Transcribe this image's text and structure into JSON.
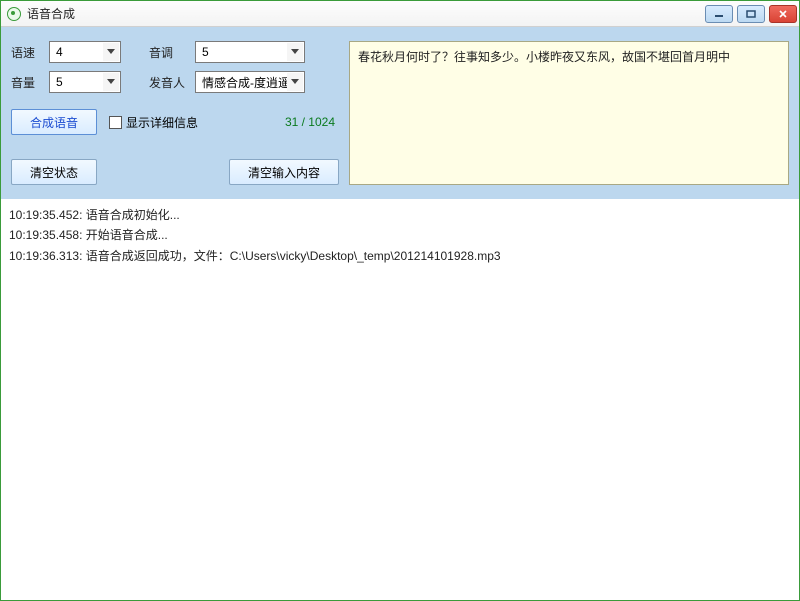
{
  "window": {
    "title": "语音合成"
  },
  "controls": {
    "speed_label": "语速",
    "speed_value": "4",
    "pitch_label": "音调",
    "pitch_value": "5",
    "volume_label": "音量",
    "volume_value": "5",
    "speaker_label": "发音人",
    "speaker_value": "情感合成-度逍遥"
  },
  "actions": {
    "synthesize_label": "合成语音",
    "show_detail_label": "显示详细信息",
    "clear_status_label": "清空状态",
    "clear_input_label": "清空输入内容"
  },
  "counter": {
    "text": "31 / 1024"
  },
  "input": {
    "text": "春花秋月何时了？往事知多少。小楼昨夜又东风，故国不堪回首月明中"
  },
  "log": {
    "lines": [
      "10:19:35.452: 语音合成初始化...",
      "10:19:35.458: 开始语音合成...",
      "10:19:36.313: 语音合成返回成功，文件：C:\\Users\\vicky\\Desktop\\_temp\\201214101928.mp3"
    ]
  }
}
